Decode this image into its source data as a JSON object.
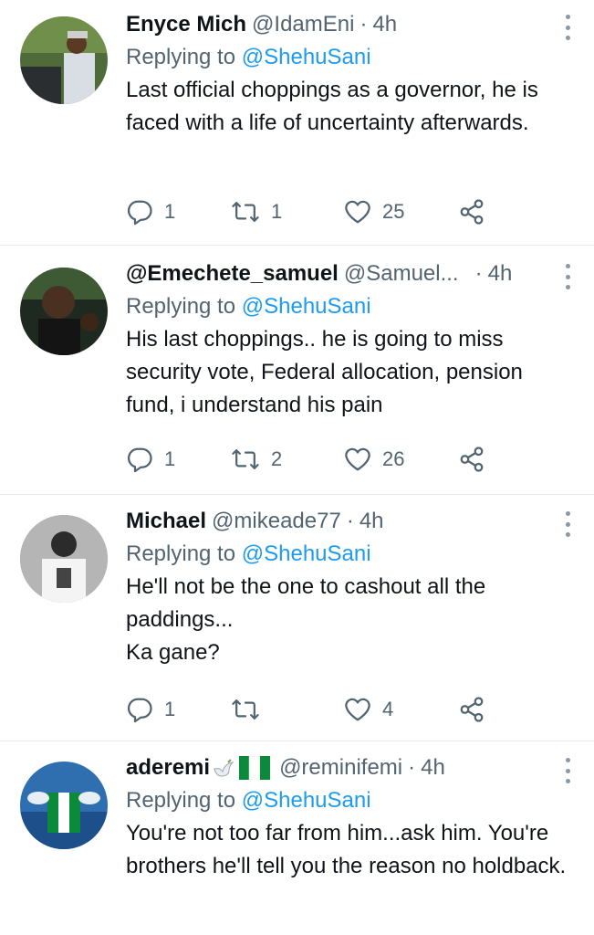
{
  "tweets": [
    {
      "name": "Enyce Mich",
      "handle": "@IdamEni",
      "dot": "·",
      "time": "4h",
      "replying_label": "Replying to",
      "replying_to": "@ShehuSani",
      "text": "Last official choppings as a governor, he is faced with a life of uncertainty afterwards.",
      "replies": "1",
      "retweets": "1",
      "likes": "25"
    },
    {
      "name": "@Emechete_samuel",
      "handle": "@Samuel...",
      "dot": "·",
      "time": "4h",
      "replying_label": "Replying to",
      "replying_to": "@ShehuSani",
      "text": "His last choppings.. he is going to miss security vote, Federal allocation, pension fund, i understand his pain",
      "replies": "1",
      "retweets": "2",
      "likes": "26"
    },
    {
      "name": "Michael",
      "handle": "@mikeade77",
      "dot": "·",
      "time": "4h",
      "replying_label": "Replying to",
      "replying_to": "@ShehuSani",
      "text_line1": "He'll not be the one to cashout all the paddings...",
      "text_line2": "Ka gane?",
      "replies": "1",
      "retweets": "",
      "likes": "4"
    },
    {
      "name": "aderemi",
      "handle": "@reminifemi",
      "dot": "·",
      "time": "4h",
      "replying_label": "Replying to",
      "replying_to": "@ShehuSani",
      "text": "You're not too far from him...ask him. You're brothers he'll tell you the reason no holdback."
    }
  ],
  "icons": {
    "reply": "reply-icon",
    "retweet": "retweet-icon",
    "like": "heart-icon",
    "share": "share-icon",
    "more": "more-icon"
  },
  "colors": {
    "link": "#1d9bf0",
    "secondary": "#536471",
    "divider": "#e6ecf0"
  }
}
